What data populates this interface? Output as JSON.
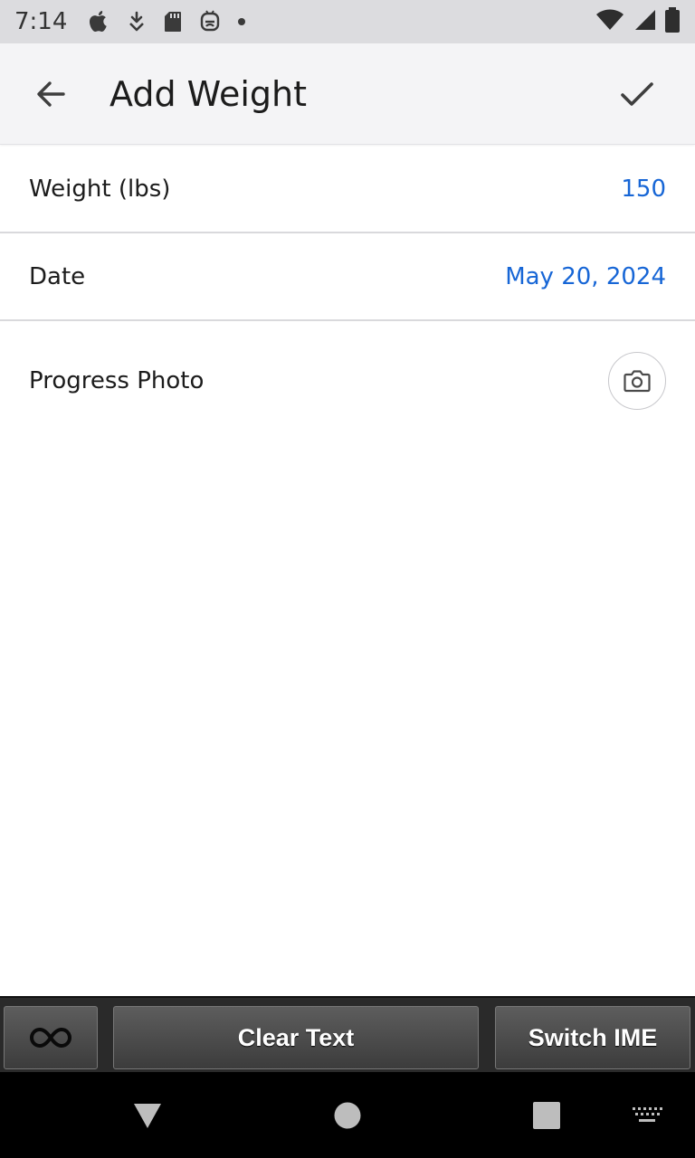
{
  "status_bar": {
    "time": "7:14",
    "icons": [
      "apple-icon",
      "download-icon",
      "sd-card-icon",
      "android-icon",
      "dot-icon"
    ],
    "right_icons": [
      "wifi-icon",
      "signal-icon",
      "battery-icon"
    ]
  },
  "app_bar": {
    "title": "Add Weight",
    "back_icon": "arrow-left-icon",
    "confirm_icon": "checkmark-icon"
  },
  "form": {
    "weight": {
      "label": "Weight (lbs)",
      "value": "150"
    },
    "date": {
      "label": "Date",
      "value": "May 20, 2024"
    },
    "photo": {
      "label": "Progress Photo",
      "icon": "camera-icon"
    }
  },
  "ime_bar": {
    "loop_icon": "infinity-icon",
    "clear_label": "Clear Text",
    "switch_label": "Switch IME"
  },
  "nav_bar": {
    "icons": [
      "back-triangle-icon",
      "home-circle-icon",
      "recents-square-icon",
      "keyboard-icon"
    ]
  },
  "colors": {
    "accent": "#1766d6",
    "status_bar_bg": "#dcdcdf",
    "app_bar_bg": "#f4f4f6"
  }
}
